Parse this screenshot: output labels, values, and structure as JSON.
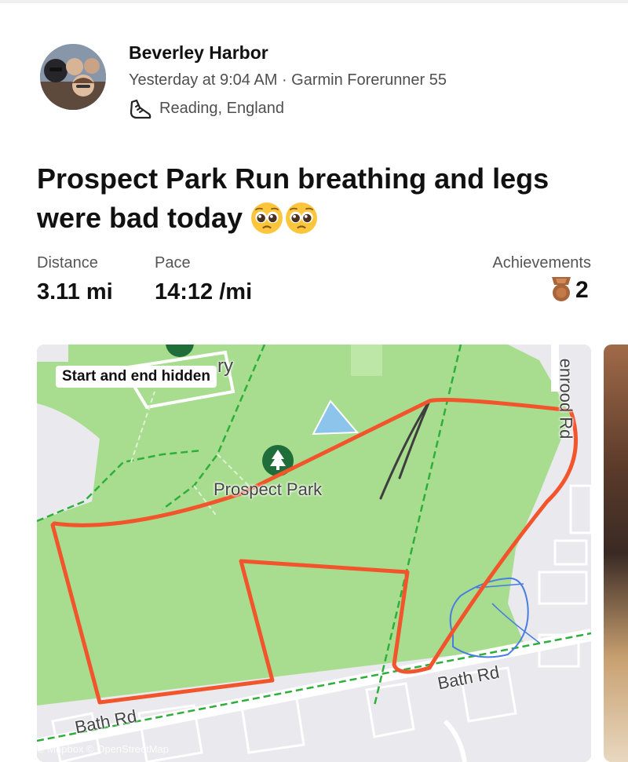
{
  "athlete": {
    "name": "Beverley Harbor",
    "meta": "Yesterday at 9:04 AM · Garmin Forerunner 55",
    "location": "Reading, England"
  },
  "activity": {
    "title": "Prospect Park Run breathing and legs were bad today",
    "emoji": [
      "pleading-face",
      "pleading-face"
    ]
  },
  "stats": {
    "distance": {
      "label": "Distance",
      "value": "3.11 mi"
    },
    "pace": {
      "label": "Pace",
      "value": "14:12 /mi"
    },
    "achievements": {
      "label": "Achievements",
      "count": "2",
      "icon": "medal-icon"
    }
  },
  "map": {
    "badge": "Start and end hidden",
    "labels": {
      "park": "Prospect Park",
      "road_bottom_left": "Bath Rd",
      "road_bottom_right": "Bath Rd",
      "road_right": "enrood Rd",
      "partial": "ry"
    },
    "attribution": "© Mapbox © OpenStreetMap",
    "colors": {
      "route": "#f2552c",
      "park": "#a8dd8f",
      "path": "#2eae3a"
    }
  }
}
